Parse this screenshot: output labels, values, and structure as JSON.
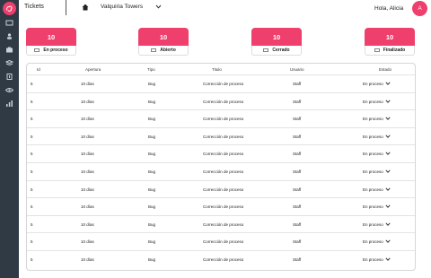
{
  "app": {
    "title": "Tickets"
  },
  "header": {
    "project": "Valquiria Towers",
    "greeting": "Hola, Alicia",
    "avatar_initial": "A"
  },
  "colors": {
    "accent": "#ee3f6d",
    "sidebar": "#2f3a45"
  },
  "sidebar": {
    "icons": [
      "logo-icon",
      "tickets-icon",
      "user-icon",
      "projects-icon",
      "layers-icon",
      "building-icon",
      "eye-icon",
      "stats-icon"
    ]
  },
  "stats": [
    {
      "value": "10",
      "label": "En proceso"
    },
    {
      "value": "10",
      "label": "Abierto"
    },
    {
      "value": "10",
      "label": "Cerrado"
    },
    {
      "value": "10",
      "label": "Finalizado"
    }
  ],
  "table": {
    "columns": [
      "Id",
      "Apertura",
      "Tipo",
      "Titulo",
      "Usuario",
      "Estado"
    ],
    "rows": [
      [
        "5",
        "10 días",
        "Bug",
        "Corrección de proceso",
        "Staff",
        "En proceso"
      ],
      [
        "5",
        "10 días",
        "Bug",
        "Corrección de proceso",
        "Staff",
        "En proceso"
      ],
      [
        "5",
        "10 días",
        "Bug",
        "Corrección de proceso",
        "Staff",
        "En proceso"
      ],
      [
        "5",
        "10 días",
        "Bug",
        "Corrección de proceso",
        "Staff",
        "En proceso"
      ],
      [
        "5",
        "10 días",
        "Bug",
        "Corrección de proceso",
        "Staff",
        "En proceso"
      ],
      [
        "5",
        "10 días",
        "Bug",
        "Corrección de proceso",
        "Staff",
        "En proceso"
      ],
      [
        "5",
        "10 días",
        "Bug",
        "Corrección de proceso",
        "Staff",
        "En proceso"
      ],
      [
        "5",
        "10 días",
        "Bug",
        "Corrección de proceso",
        "Staff",
        "En proceso"
      ],
      [
        "5",
        "10 días",
        "Bug",
        "Corrección de proceso",
        "Staff",
        "En proceso"
      ],
      [
        "5",
        "10 días",
        "Bug",
        "Corrección de proceso",
        "Staff",
        "En proceso"
      ],
      [
        "5",
        "10 días",
        "Bug",
        "Corrección de proceso",
        "Staff",
        "En proceso"
      ]
    ]
  }
}
